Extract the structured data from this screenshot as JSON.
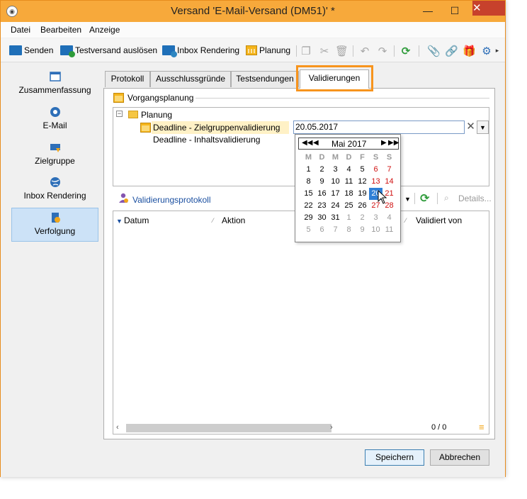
{
  "window": {
    "title": "Versand 'E-Mail-Versand  (DM51)' *",
    "minimize": "—",
    "maximize": "☐",
    "close": "✕"
  },
  "menu": [
    "Datei",
    "Bearbeiten",
    "Anzeige"
  ],
  "toolbar": {
    "send": "Senden",
    "test_send": "Testversand auslösen",
    "inbox_rendering": "Inbox Rendering",
    "planning": "Planung"
  },
  "nav": [
    {
      "label": "Zusammenfassung",
      "icon": "summary-icon"
    },
    {
      "label": "E-Mail",
      "icon": "email-icon"
    },
    {
      "label": "Zielgruppe",
      "icon": "target-group-icon"
    },
    {
      "label": "Inbox Rendering",
      "icon": "globe-icon"
    },
    {
      "label": "Verfolgung",
      "icon": "tracking-icon",
      "selected": true
    }
  ],
  "tabs": [
    "Protokoll",
    "Ausschlussgründe",
    "Testsendungen",
    "Validierungen"
  ],
  "active_tab": "Validierungen",
  "group": {
    "title": "Vorgangsplanung"
  },
  "tree": {
    "root": "Planung",
    "expander": "−",
    "items": [
      {
        "label": "Deadline - Zielgruppenvalidierung",
        "value": "20.05.2017"
      },
      {
        "label": "Deadline - Inhaltsvalidierung"
      }
    ]
  },
  "calendar": {
    "month_label": "Mai 2017",
    "weekdays": [
      "M",
      "D",
      "M",
      "D",
      "F",
      "S",
      "S"
    ],
    "weeks": [
      [
        "1",
        "2",
        "3",
        "4",
        "5",
        "6",
        "7"
      ],
      [
        "8",
        "9",
        "10",
        "11",
        "12",
        "13",
        "14"
      ],
      [
        "15",
        "16",
        "17",
        "18",
        "19",
        "20",
        "21"
      ],
      [
        "22",
        "23",
        "24",
        "25",
        "26",
        "27",
        "28"
      ],
      [
        "29",
        "30",
        "31",
        "1",
        "2",
        "3",
        "4"
      ],
      [
        "5",
        "6",
        "7",
        "8",
        "9",
        "10",
        "11"
      ]
    ],
    "selected_day": "20"
  },
  "validation_log": {
    "title": "Validierungsprotokoll",
    "details": "Details...",
    "columns": [
      "Datum",
      "Aktion",
      "Validiert von"
    ],
    "count": "0 / 0"
  },
  "buttons": {
    "save": "Speichern",
    "cancel": "Abbrechen"
  }
}
